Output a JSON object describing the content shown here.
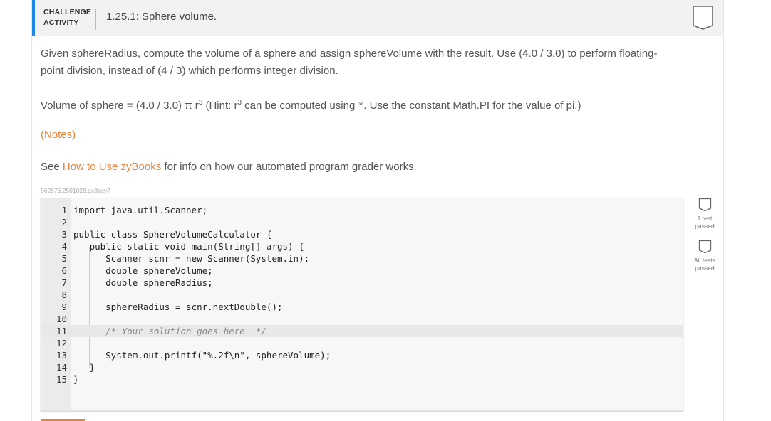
{
  "header": {
    "label_line1": "CHALLENGE",
    "label_line2": "ACTIVITY",
    "title": "1.25.1: Sphere volume."
  },
  "instructions": {
    "p1_line1": "Given sphereRadius, compute the volume of a sphere and assign sphereVolume with the result. Use (4.0 / 3.0) to perform floating-",
    "p1_line2": "point division, instead of (4 / 3) which performs integer division.",
    "p2_prefix": "Volume of sphere = (4.0 / 3.0) π r",
    "p2_sup1": "3",
    "p2_mid": " (Hint: r",
    "p2_sup2": "3",
    "p2_mid2": " can be computed using ",
    "p2_op": "*",
    "p2_suffix": ". Use the constant Math.PI for the value of pi.)",
    "notes_link": "(Notes)",
    "p3_prefix": "See ",
    "p3_link": "How to Use zyBooks",
    "p3_suffix": " for info on how our automated program grader works."
  },
  "code_id": "562876.2501028.qx3zqy7",
  "code_lines": [
    {
      "n": "1",
      "text": "import java.util.Scanner;"
    },
    {
      "n": "2",
      "text": ""
    },
    {
      "n": "3",
      "text": "public class SphereVolumeCalculator {"
    },
    {
      "n": "4",
      "text": "   public static void main(String[] args) {"
    },
    {
      "n": "5",
      "text": "      Scanner scnr = new Scanner(System.in);"
    },
    {
      "n": "6",
      "text": "      double sphereVolume;"
    },
    {
      "n": "7",
      "text": "      double sphereRadius;"
    },
    {
      "n": "8",
      "text": ""
    },
    {
      "n": "9",
      "text": "      sphereRadius = scnr.nextDouble();"
    },
    {
      "n": "10",
      "text": ""
    },
    {
      "n": "11",
      "text": "      /* Your solution goes here  */"
    },
    {
      "n": "12",
      "text": ""
    },
    {
      "n": "13",
      "text": "      System.out.printf(\"%.2f\\n\", sphereVolume);"
    },
    {
      "n": "14",
      "text": "   }"
    },
    {
      "n": "15",
      "text": "}"
    }
  ],
  "tests": {
    "test1_line1": "1 test",
    "test1_line2": "passed",
    "test2_line1": "All tests",
    "test2_line2": "passed"
  },
  "colors": {
    "accent_blue": "#1e88e5",
    "link_orange": "#e8833a"
  }
}
